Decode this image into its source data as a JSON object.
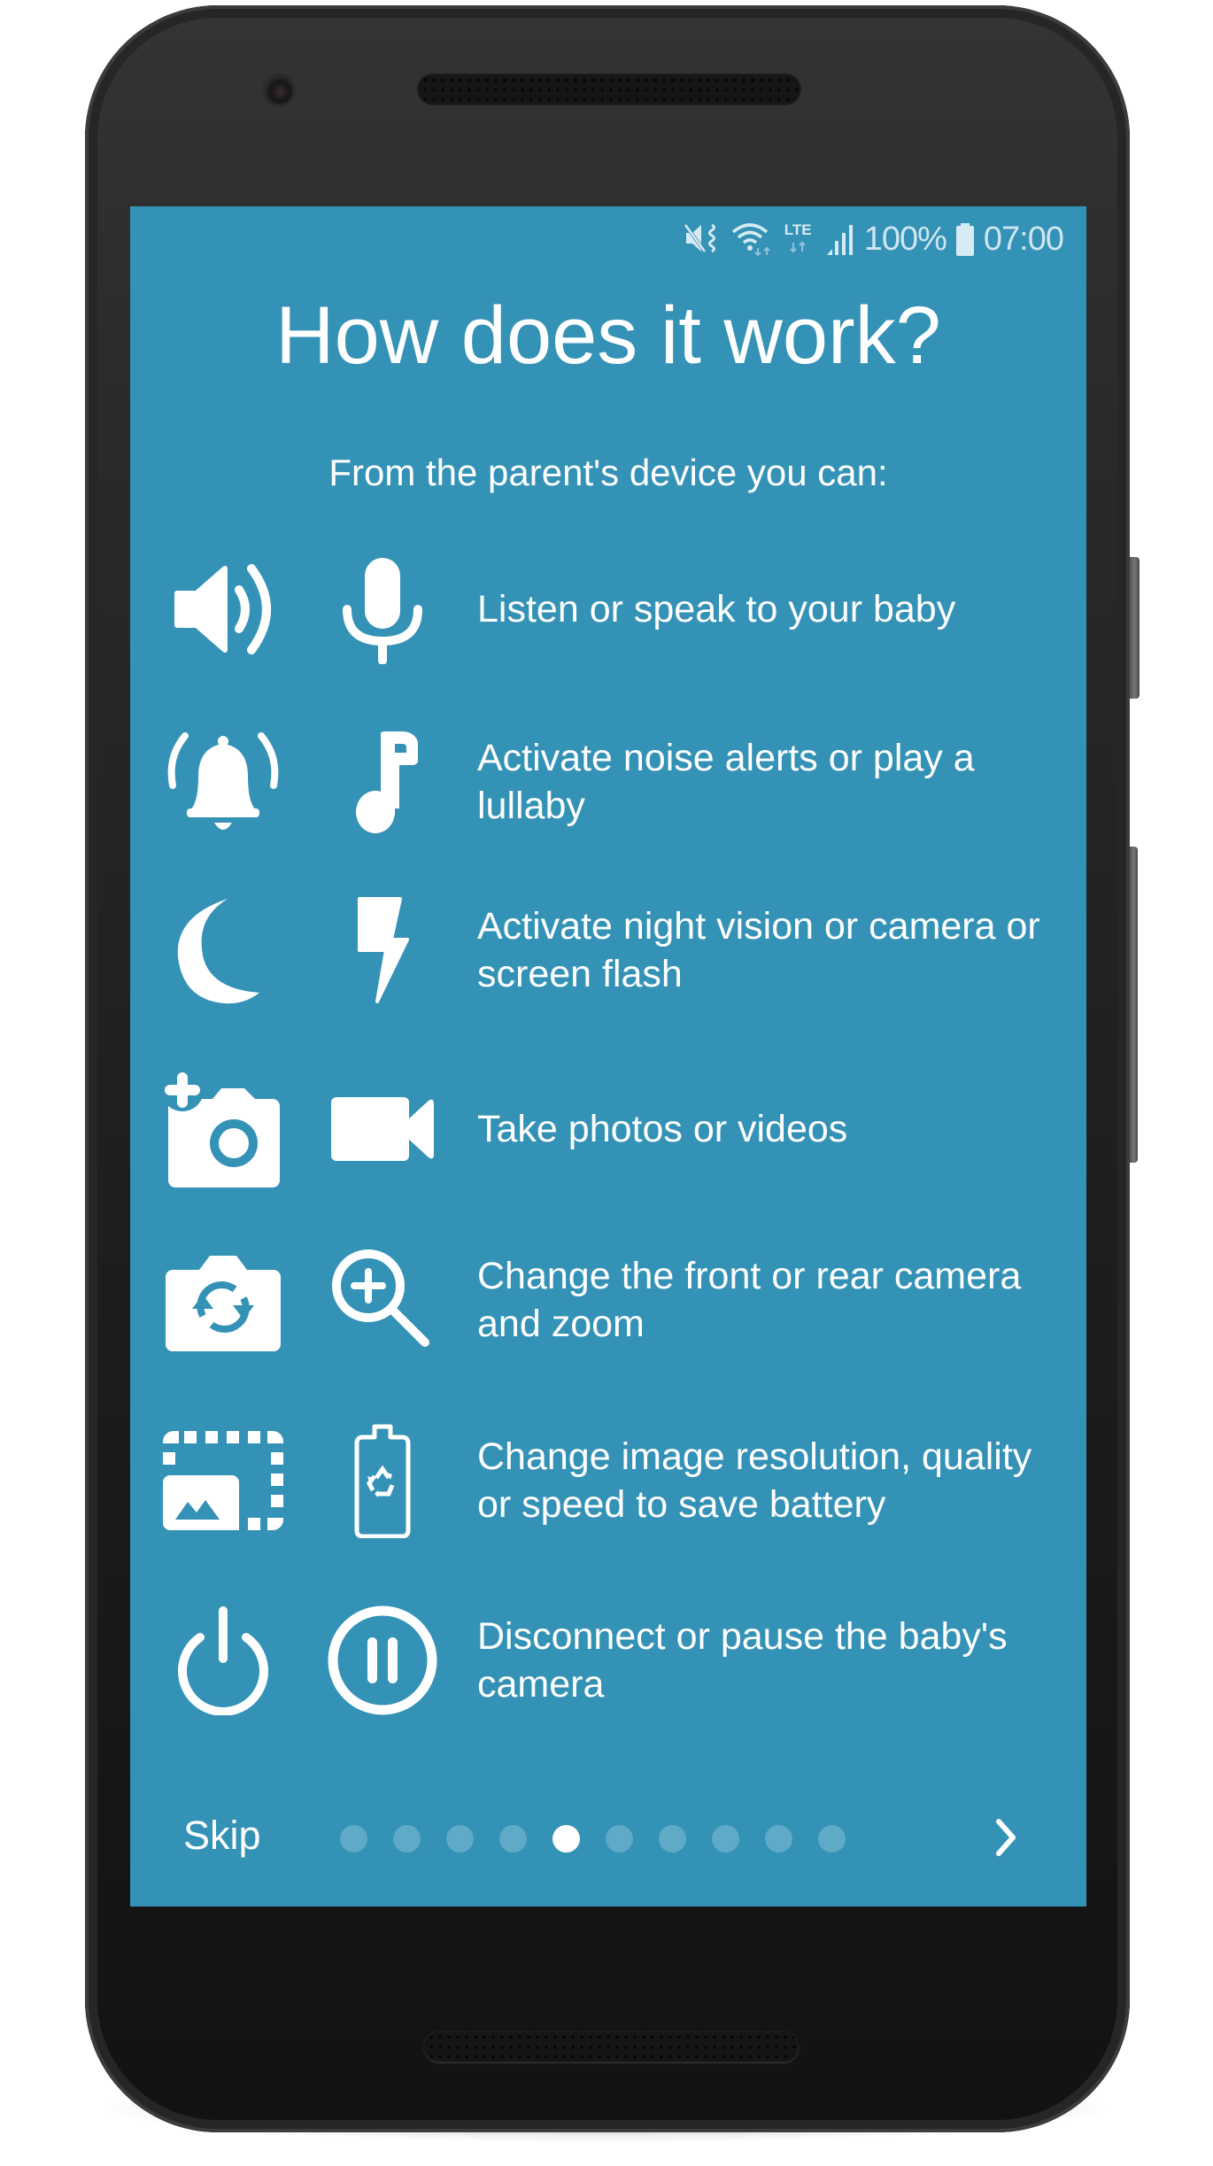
{
  "status_bar": {
    "icons": [
      "vibrate-mute-icon",
      "wifi-icon",
      "lte-icon",
      "signal-icon",
      "battery-icon"
    ],
    "lte_label": "LTE",
    "battery_percent": "100%",
    "time": "07:00"
  },
  "screen": {
    "title": "How does it work?",
    "subtitle": "From the parent's device you can:",
    "background_color": "#3392b6",
    "features": [
      {
        "icons": [
          "speaker-volume-icon",
          "microphone-icon"
        ],
        "text": "Listen or speak to your baby"
      },
      {
        "icons": [
          "ringing-bell-icon",
          "music-note-icon"
        ],
        "text": "Activate noise alerts or play a lullaby"
      },
      {
        "icons": [
          "moon-icon",
          "flash-icon"
        ],
        "text": "Activate night vision or camera or screen flash"
      },
      {
        "icons": [
          "add-photo-camera-icon",
          "video-camera-icon"
        ],
        "text": "Take photos or videos"
      },
      {
        "icons": [
          "switch-camera-icon",
          "zoom-in-icon"
        ],
        "text": "Change the front or rear camera and zoom"
      },
      {
        "icons": [
          "image-resolution-icon",
          "eco-battery-icon"
        ],
        "text": "Change image resolution, quality or speed to save battery"
      },
      {
        "icons": [
          "power-icon",
          "pause-circle-icon"
        ],
        "text": "Disconnect or pause the baby's camera"
      }
    ]
  },
  "footer": {
    "skip_label": "Skip",
    "page_count": 10,
    "current_page": 5,
    "next_icon": "chevron-right-icon"
  }
}
